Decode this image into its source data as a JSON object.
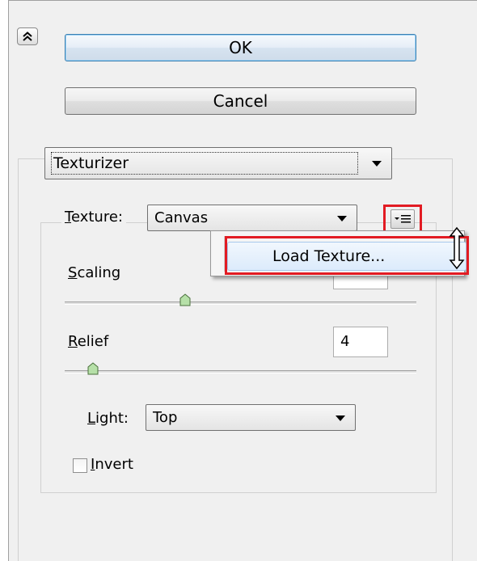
{
  "buttons": {
    "ok": "OK",
    "cancel": "Cancel"
  },
  "filter": {
    "selected": "Texturizer"
  },
  "texture": {
    "label_key": "T",
    "label_rest": "exture:",
    "selected": "Canvas",
    "menu": {
      "item": "Load Texture..."
    }
  },
  "scaling": {
    "label_key": "S",
    "label_rest": "caling",
    "value": ""
  },
  "relief": {
    "label_key": "R",
    "label_rest": "elief",
    "value": "4",
    "level": 4,
    "max": 50
  },
  "light": {
    "label_key": "L",
    "label_rest": "ight:",
    "selected": "Top"
  },
  "invert": {
    "label_key": "I",
    "label_rest": "nvert",
    "checked": false
  },
  "colors": {
    "highlight": "#e21b23",
    "ok_border": "#3c7fb1"
  },
  "icons": {
    "collapse": "double-chevron-up-icon",
    "menu": "panel-menu-icon",
    "cursor": "resize-vertical-cursor-icon"
  }
}
